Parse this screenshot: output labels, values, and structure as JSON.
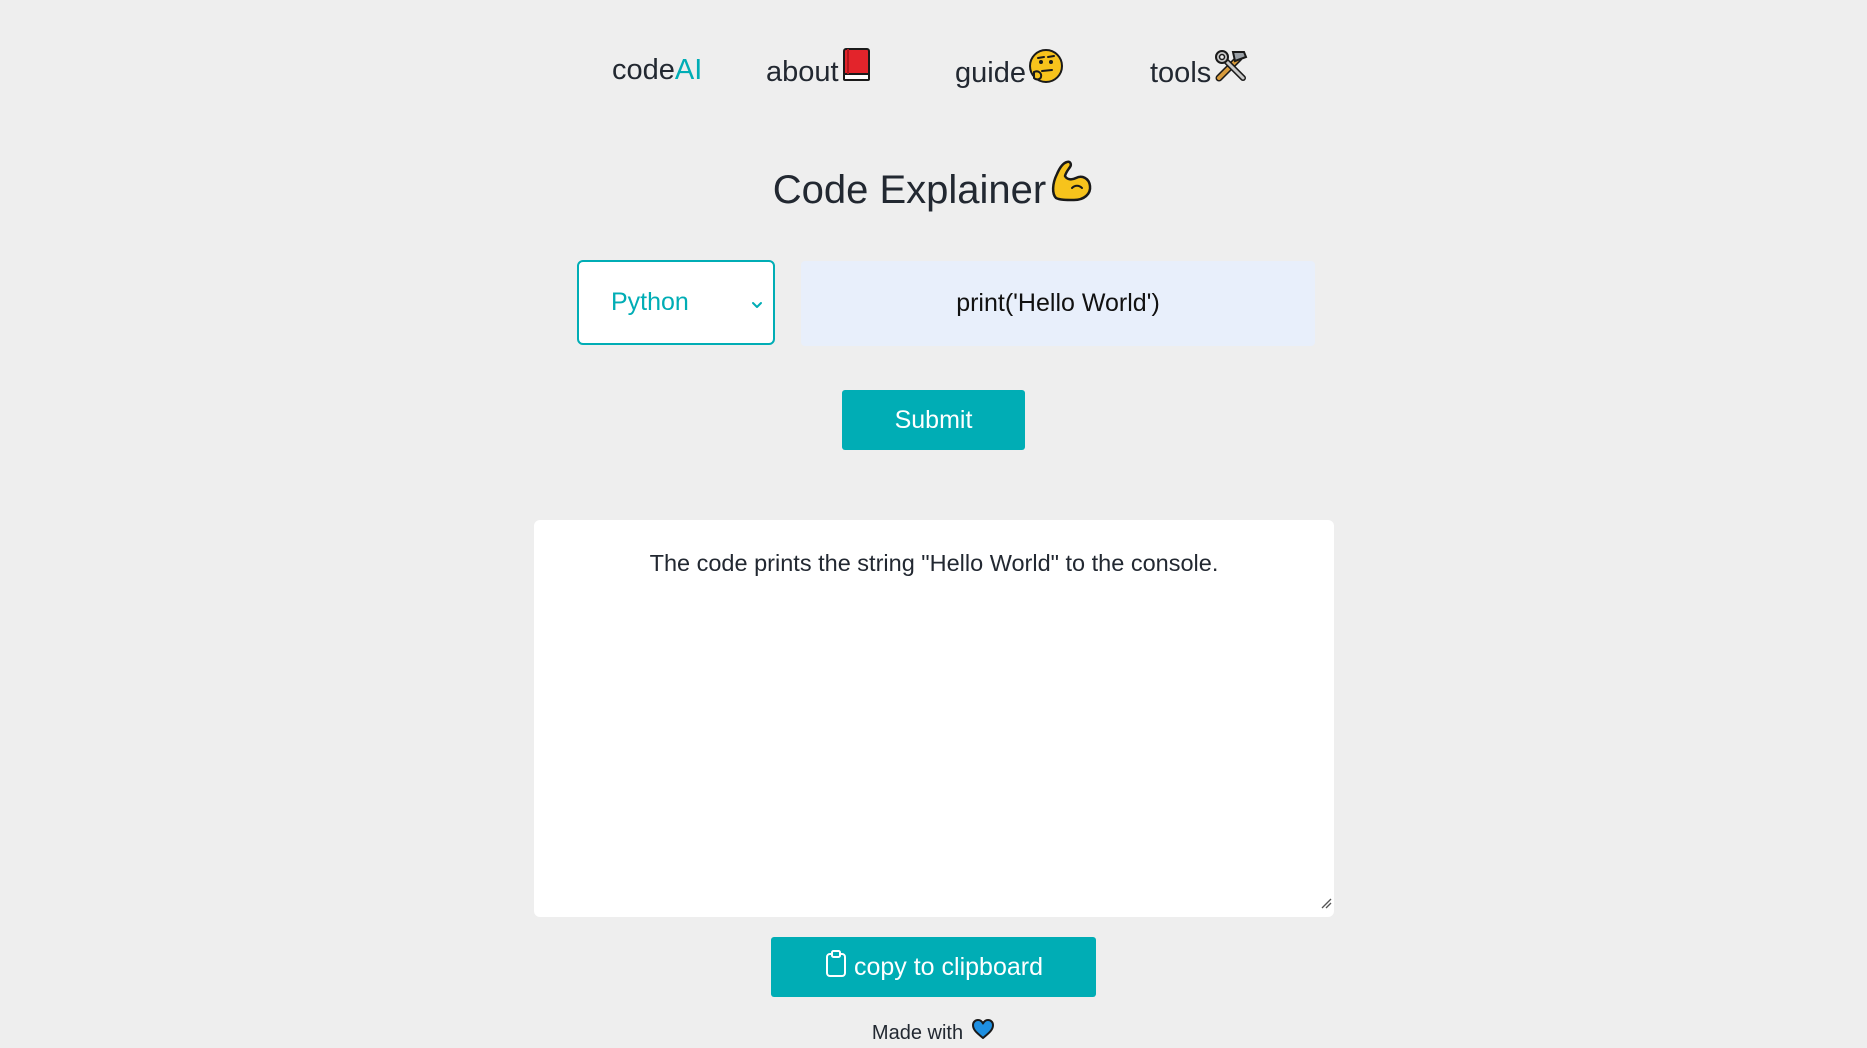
{
  "nav": {
    "brand_prefix": "code",
    "brand_accent": "AI",
    "about": "about",
    "about_icon": "red-book-icon",
    "guide": "guide",
    "guide_icon": "thinking-face-icon",
    "tools": "tools",
    "tools_icon": "hammer-wrench-icon"
  },
  "page": {
    "title": "Code Explainer",
    "title_icon": "flexed-biceps-icon"
  },
  "form": {
    "language_selected": "Python",
    "code_value": "print('Hello World')",
    "submit_label": "Submit"
  },
  "output": {
    "text": "The code prints the string \"Hello World\" to the console.",
    "copy_label": "copy to clipboard",
    "copy_icon": "clipboard-icon"
  },
  "footer": {
    "text": "Made with",
    "icon": "blue-heart-icon"
  },
  "colors": {
    "accent": "#00adb5",
    "background": "#eeeeee",
    "text": "#222831",
    "input_bg": "#e8effb"
  }
}
